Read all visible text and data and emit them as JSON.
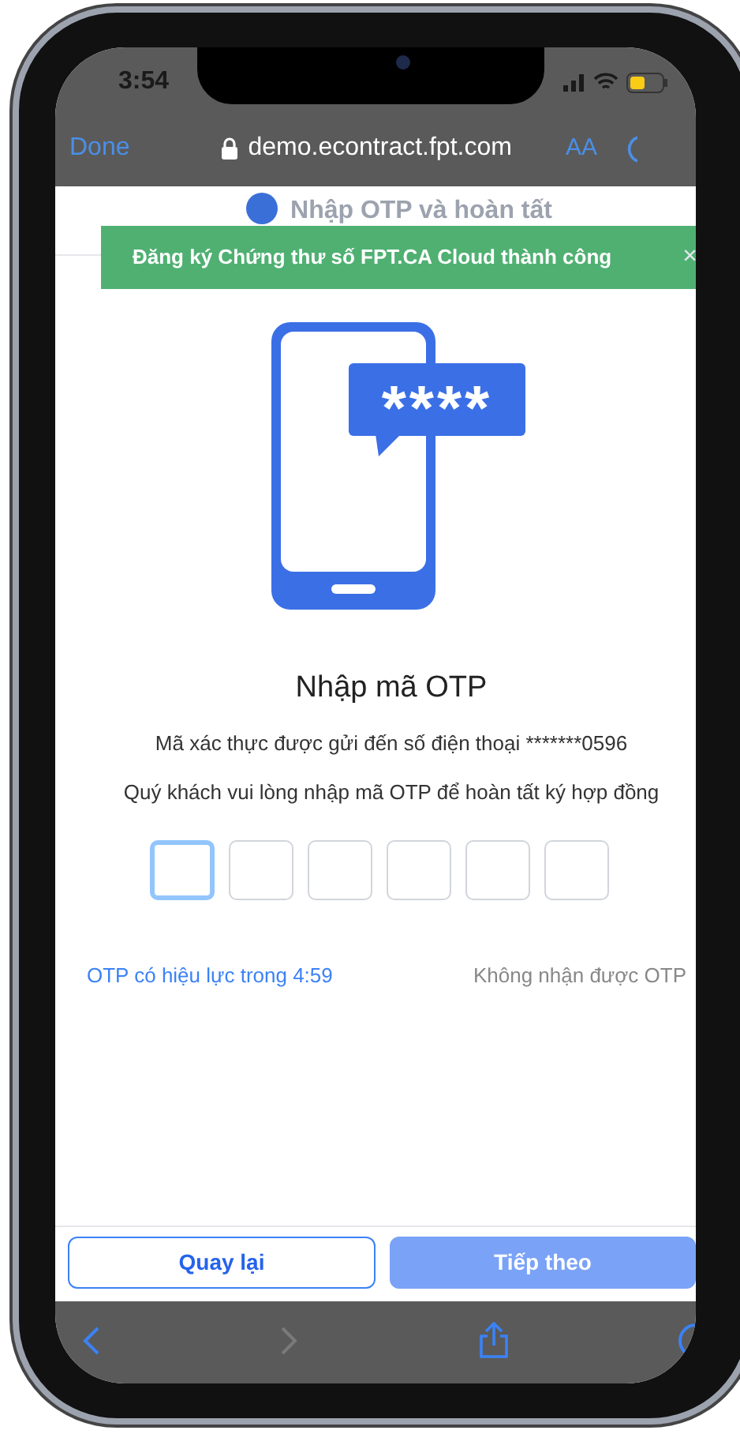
{
  "status_bar": {
    "time": "3:54"
  },
  "browser": {
    "done": "Done",
    "url": "demo.econtract.fpt.com",
    "text_size": "AA"
  },
  "step": {
    "title": "Nhập OTP và hoàn tất"
  },
  "toast": {
    "message": "Đăng ký Chứng thư số FPT.CA Cloud thành công",
    "close": "×"
  },
  "illustration": {
    "masked_code": "****"
  },
  "otp": {
    "title": "Nhập mã OTP",
    "sent_to": "Mã xác thực được gửi đến số điện thoại *******0596",
    "instruction": "Quý khách vui lòng nhập mã OTP để hoàn tất ký hợp đồng",
    "boxes": [
      {
        "selected": true
      },
      {
        "selected": false
      },
      {
        "selected": false
      },
      {
        "selected": false
      },
      {
        "selected": false
      },
      {
        "selected": false
      }
    ],
    "timer": "OTP có hiệu lực trong 4:59",
    "resend": "Không nhận được OTP"
  },
  "buttons": [
    {
      "label": "Quay lại",
      "kind": "outline",
      "disabled": false
    },
    {
      "label": "Tiếp theo",
      "kind": "filled",
      "disabled": true
    }
  ],
  "toolbar": [
    {
      "kind": "back",
      "disabled": false
    },
    {
      "kind": "forward",
      "disabled": true
    },
    {
      "kind": "share",
      "disabled": false
    },
    {
      "kind": "compass",
      "disabled": false
    }
  ]
}
